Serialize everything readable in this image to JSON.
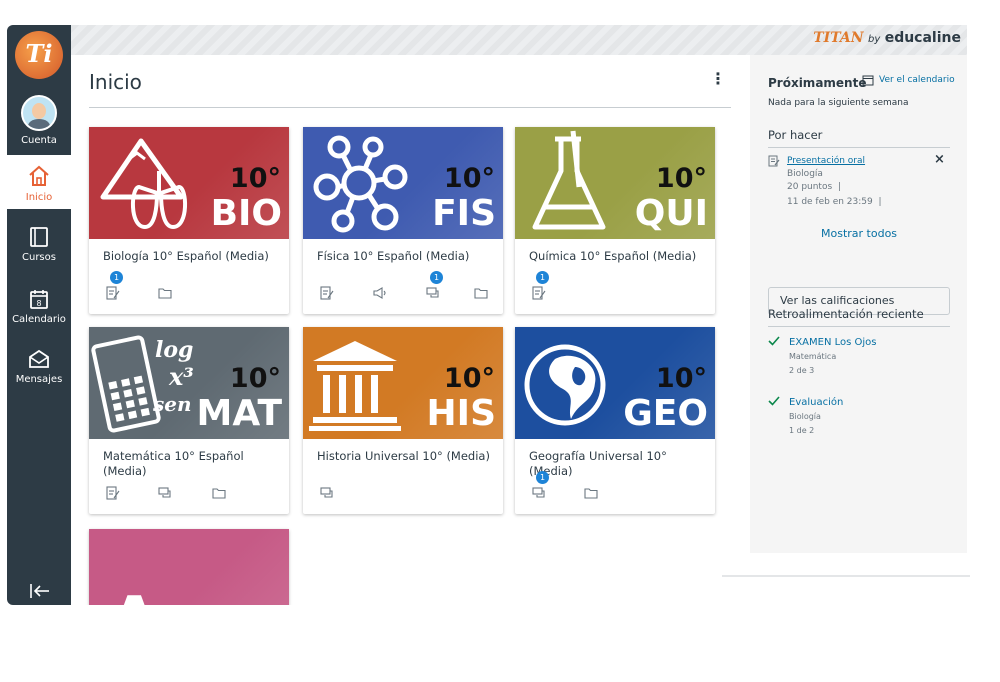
{
  "brand": {
    "titan": "TITAN",
    "by": "by",
    "edu": "educaline"
  },
  "nav": {
    "logo": "Ti",
    "items": [
      {
        "label": "Cuenta",
        "icon": "avatar"
      },
      {
        "label": "Inicio",
        "icon": "home-icon",
        "active": true
      },
      {
        "label": "Cursos",
        "icon": "book-icon"
      },
      {
        "label": "Calendario",
        "icon": "calendar-icon"
      },
      {
        "label": "Mensajes",
        "icon": "inbox-icon"
      }
    ],
    "collapse_icon": "collapse-arrow-icon"
  },
  "main": {
    "title": "Inicio",
    "menu_icon": "kebab-icon"
  },
  "cards": [
    {
      "grade": "10°",
      "code": "BIO",
      "name": "Biología 10° Español (Media)",
      "color": "#b8383f",
      "badges": {
        "0": "1"
      }
    },
    {
      "grade": "10°",
      "code": "FIS",
      "name": "Física 10° Español (Media)",
      "color": "#3f5bb0",
      "badges": {
        "2": "1"
      }
    },
    {
      "grade": "10°",
      "code": "QUI",
      "name": "Química 10° Español (Media)",
      "color": "#9aa046",
      "badges": {
        "0": "1"
      }
    },
    {
      "grade": "10°",
      "code": "MAT",
      "name": "Matemática 10° Español (Media)",
      "color": "#5f6a72",
      "badges": {}
    },
    {
      "grade": "10°",
      "code": "HIS",
      "name": "Historia Universal 10° (Media)",
      "color": "#d27a24",
      "badges": {}
    },
    {
      "grade": "10°",
      "code": "GEO",
      "name": "Geografía Universal 10° (Media)",
      "color": "#1d4f9f",
      "badges": {
        "0": "1"
      }
    },
    {
      "grade": "",
      "code": "",
      "name": "",
      "color": "#c65a86",
      "badges": {}
    }
  ],
  "sidebar": {
    "upcoming": {
      "title": "Próximamente",
      "calendar_link": "Ver el calendario",
      "empty": "Nada para la siguiente semana"
    },
    "todo": {
      "title": "Por hacer",
      "items": [
        {
          "title": "Presentación oral",
          "course": "Biología",
          "points": "20 puntos",
          "sep": "|",
          "due": "11 de feb en 23:59",
          "sep2": "|"
        }
      ],
      "show_all": "Mostrar todos"
    },
    "grades_button": "Ver las calificaciones",
    "feedback": {
      "title": "Retroalimentación reciente",
      "items": [
        {
          "title": "EXAMEN Los Ojos",
          "course": "Matemática",
          "score": "2 de 3"
        },
        {
          "title": "Evaluación",
          "course": "Biología",
          "score": "1 de 2"
        }
      ]
    }
  },
  "colors": {
    "nav_bg": "#2d3b45",
    "accent": "#e66135",
    "link": "#0770a3",
    "badge": "#1e84d7"
  }
}
